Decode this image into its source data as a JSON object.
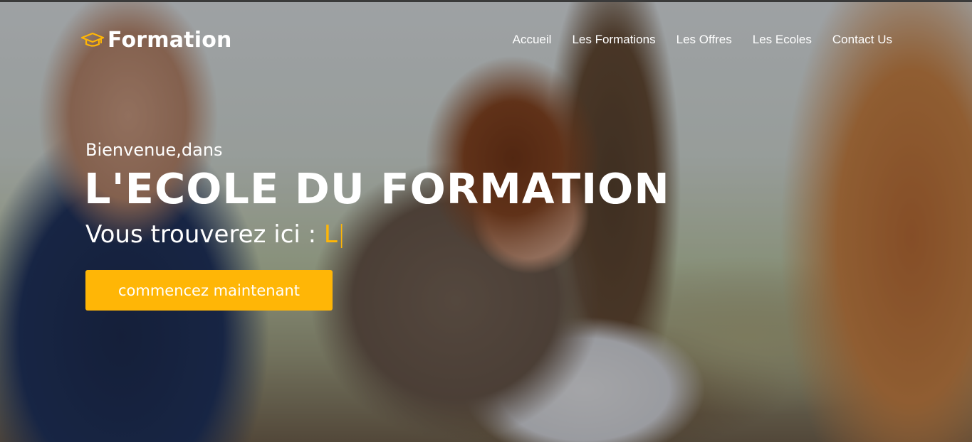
{
  "colors": {
    "accent": "#ffb606",
    "text": "#ffffff"
  },
  "header": {
    "brand_icon": "graduation-cap-icon",
    "brand_name": "Formation",
    "nav": [
      {
        "label": "Accueil"
      },
      {
        "label": "Les Formations"
      },
      {
        "label": "Les Offres"
      },
      {
        "label": "Les Ecoles"
      },
      {
        "label": "Contact Us"
      }
    ]
  },
  "hero": {
    "welcome": "Bienvenue,dans",
    "headline": "L'ECOLE DU FORMATION",
    "subtitle_prefix": "Vous trouverez ici : ",
    "typed_text": "L",
    "cursor": "|",
    "cta_label": "commencez maintenant"
  }
}
